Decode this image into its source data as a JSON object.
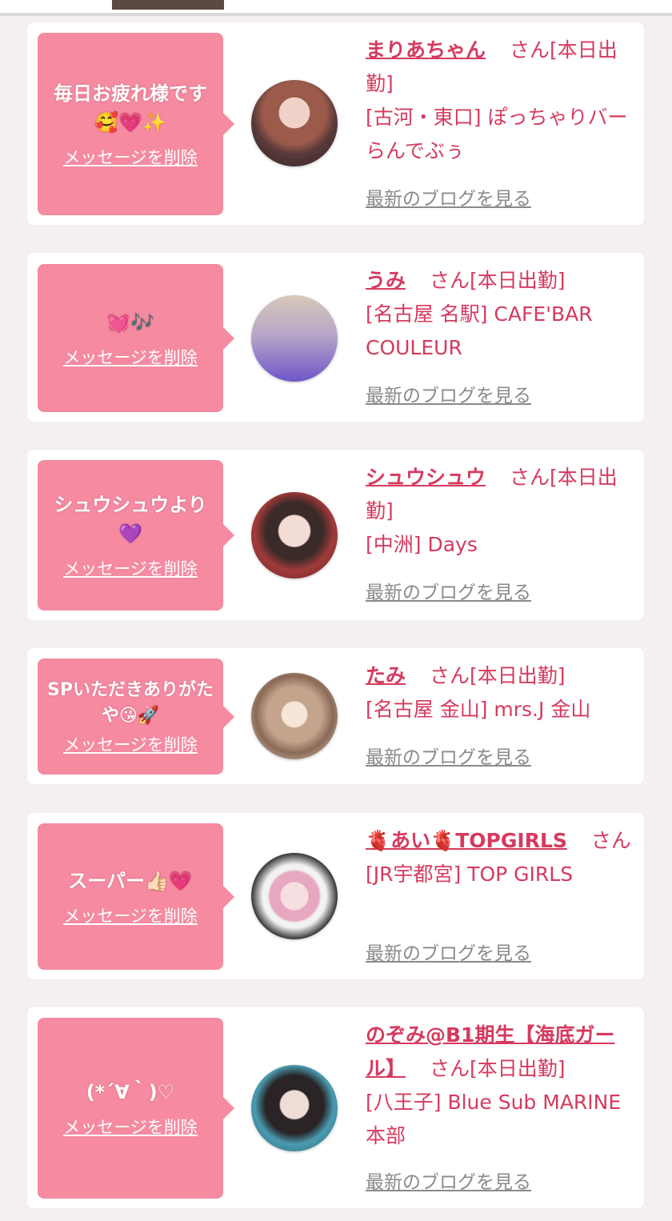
{
  "cards": [
    {
      "message": "毎日お疲れ様です\n🥰💗✨",
      "delete_label": "メッセージを削除",
      "name": "まりあちゃん",
      "suffix": "さん[本日出勤]",
      "shop": "[古河・東口] ぽっちゃりバー らんでぶぅ",
      "blog_label": "最新のブログを見る"
    },
    {
      "message": "💓🎶",
      "delete_label": "メッセージを削除",
      "name": "うみ",
      "suffix": "さん[本日出勤]",
      "shop": "[名古屋 名駅] CAFE'BAR COULEUR",
      "blog_label": "最新のブログを見る"
    },
    {
      "message": "シュウシュウより\n💜",
      "delete_label": "メッセージを削除",
      "name": "シュウシュウ",
      "suffix": "さん[本日出勤]",
      "shop": "[中洲] Days",
      "blog_label": "最新のブログを見る"
    },
    {
      "message": "SPいただきありがたや😘🚀",
      "delete_label": "メッセージを削除",
      "name": "たみ",
      "suffix": "さん[本日出勤]",
      "shop": "[名古屋 金山] mrs.J 金山",
      "blog_label": "最新のブログを見る"
    },
    {
      "message": "スーパー👍🏻💗",
      "delete_label": "メッセージを削除",
      "name": "🫀あい🫀TOPGIRLS",
      "suffix": "さん",
      "shop": "[JR宇都宮] TOP GIRLS",
      "blog_label": "最新のブログを見る"
    },
    {
      "message": "(*´∀｀)♡",
      "delete_label": "メッセージを削除",
      "name": "のぞみ@B1期生【海底ガール】",
      "suffix": "さん[本日出勤]",
      "shop": "[八王子] Blue Sub MARINE 本部",
      "blog_label": "最新のブログを見る"
    }
  ],
  "colors": {
    "accent": "#d63a5e",
    "bubble": "#f58aa0",
    "link_gray": "#8a8a8a"
  }
}
